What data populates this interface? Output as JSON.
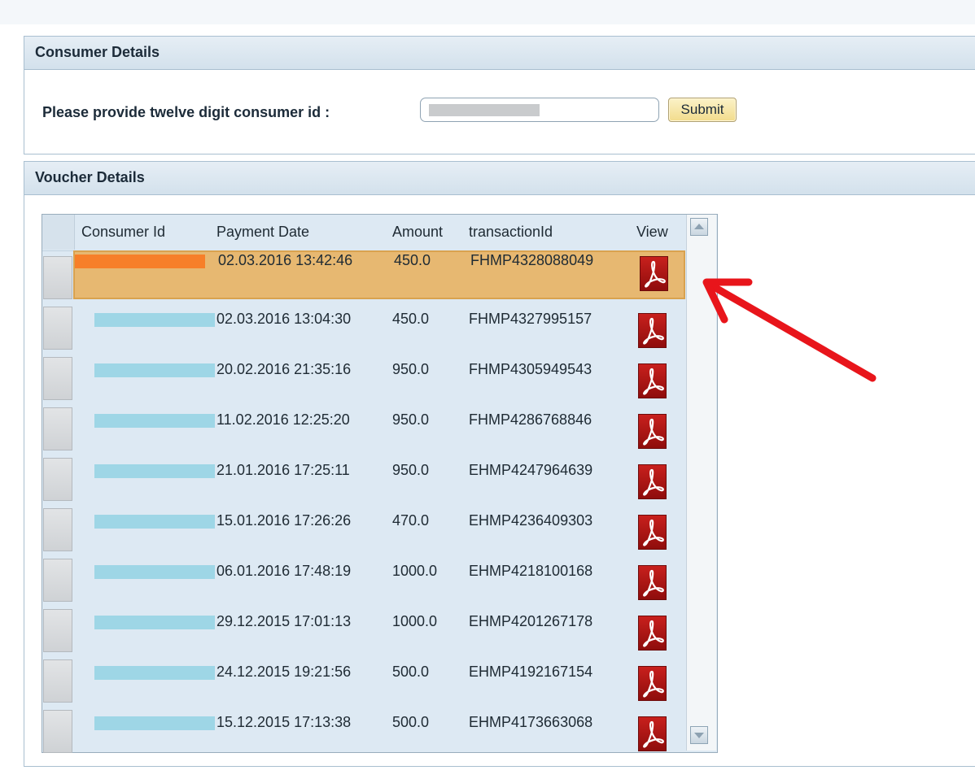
{
  "consumer_panel": {
    "title": "Consumer Details",
    "prompt_label": "Please provide twelve digit consumer id :",
    "input_value": "",
    "submit_label": "Submit"
  },
  "voucher_panel": {
    "title": "Voucher Details",
    "columns": [
      "Consumer Id",
      "Payment Date",
      "Amount",
      "transactionId",
      "View"
    ],
    "rows": [
      {
        "payment_date": "02.03.2016 13:42:46",
        "amount": "450.0",
        "transaction_id": "FHMP4328088049",
        "selected": true
      },
      {
        "payment_date": "02.03.2016 13:04:30",
        "amount": "450.0",
        "transaction_id": "FHMP4327995157",
        "selected": false
      },
      {
        "payment_date": "20.02.2016 21:35:16",
        "amount": "950.0",
        "transaction_id": "FHMP4305949543",
        "selected": false
      },
      {
        "payment_date": "11.02.2016 12:25:20",
        "amount": "950.0",
        "transaction_id": "FHMP4286768846",
        "selected": false
      },
      {
        "payment_date": "21.01.2016 17:25:11",
        "amount": "950.0",
        "transaction_id": "EHMP4247964639",
        "selected": false
      },
      {
        "payment_date": "15.01.2016 17:26:26",
        "amount": "470.0",
        "transaction_id": "EHMP4236409303",
        "selected": false
      },
      {
        "payment_date": "06.01.2016 17:48:19",
        "amount": "1000.0",
        "transaction_id": "EHMP4218100168",
        "selected": false
      },
      {
        "payment_date": "29.12.2015 17:01:13",
        "amount": "1000.0",
        "transaction_id": "EHMP4201267178",
        "selected": false
      },
      {
        "payment_date": "24.12.2015 19:21:56",
        "amount": "500.0",
        "transaction_id": "EHMP4192167154",
        "selected": false
      },
      {
        "payment_date": "15.12.2015 17:13:38",
        "amount": "500.0",
        "transaction_id": "EHMP4173663068",
        "selected": false
      }
    ]
  },
  "icons": {
    "view": "pdf-icon",
    "scroll_up": "scroll-up-arrow-icon",
    "scroll_down": "scroll-down-arrow-icon",
    "annotation": "red-arrow-annotation"
  },
  "colors": {
    "header_bg": "#d8e4ee",
    "selected_row": "#e7b871",
    "masked_id": "#9ed6e6",
    "masked_id_selected": "#f77f29",
    "pdf_icon": "#b3130f",
    "annotation_arrow": "#e8151b"
  }
}
